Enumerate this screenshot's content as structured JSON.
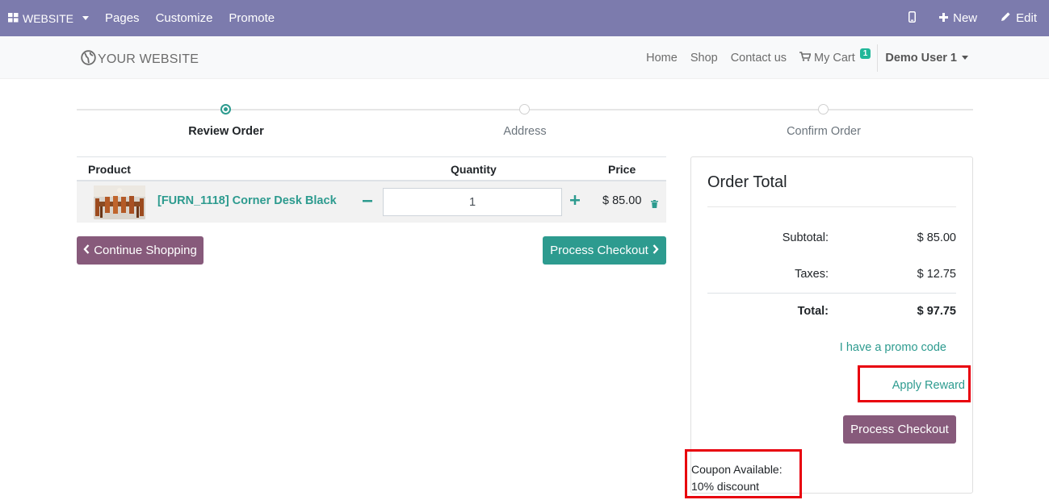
{
  "admin_bar": {
    "website_label": "WEBSITE",
    "menu": [
      "Pages",
      "Customize",
      "Promote"
    ],
    "new_label": "New",
    "edit_label": "Edit"
  },
  "header": {
    "logo_text": "YOUR WEBSITE",
    "nav": [
      "Home",
      "Shop",
      "Contact us"
    ],
    "cart_label": "My Cart",
    "cart_count": "1",
    "user_name": "Demo User 1"
  },
  "wizard": {
    "steps": [
      "Review Order",
      "Address",
      "Confirm Order"
    ],
    "active_step": 0
  },
  "cart": {
    "headers": {
      "product": "Product",
      "quantity": "Quantity",
      "price": "Price"
    },
    "items": [
      {
        "name": "[FURN_1118] Corner Desk Black",
        "quantity": "1",
        "price": "$ 85.00"
      }
    ],
    "continue_label": "Continue Shopping",
    "checkout_label": "Process Checkout"
  },
  "order_total": {
    "title": "Order Total",
    "subtotal_label": "Subtotal:",
    "subtotal_value": "$ 85.00",
    "taxes_label": "Taxes:",
    "taxes_value": "$ 12.75",
    "total_label": "Total:",
    "total_value": "$ 97.75",
    "promo_label": "I have a promo code",
    "reward_label": "Apply Reward",
    "checkout_label": "Process Checkout",
    "coupon_line1": "Coupon Available:",
    "coupon_line2": "10% discount"
  },
  "colors": {
    "admin_bar": "#7c7bad",
    "primary": "#875a7b",
    "accent": "#2d9b8f",
    "highlight": "#e8000d"
  }
}
